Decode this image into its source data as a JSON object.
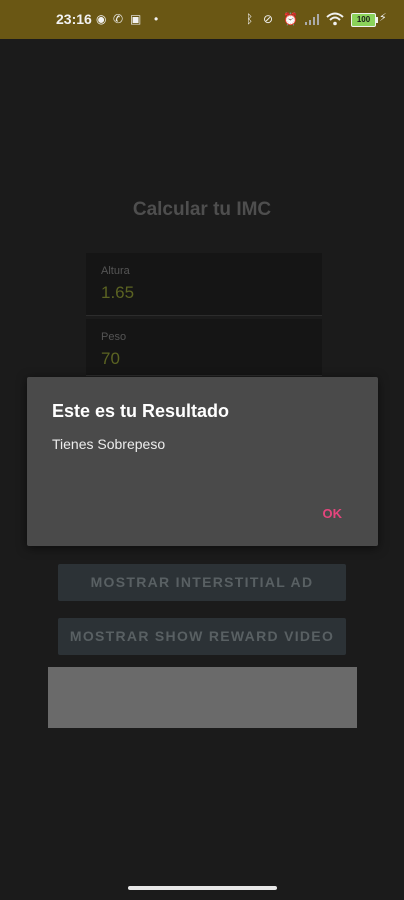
{
  "status_bar": {
    "time": "23:16",
    "battery": "100",
    "icons": [
      "messenger-icon",
      "whatsapp-icon",
      "notification-icon",
      "dot-icon",
      "bluetooth-icon",
      "mute-icon",
      "alarm-icon",
      "signal-icon",
      "wifi-icon",
      "battery-icon",
      "charging-icon"
    ]
  },
  "app": {
    "title": "Calcular tu IMC",
    "fields": {
      "height": {
        "label": "Altura",
        "value": "1.65"
      },
      "weight": {
        "label": "Peso",
        "value": "70"
      }
    },
    "buttons": {
      "interstitial": "MOSTRAR INTERSTITIAL AD",
      "reward": "MOSTRAR SHOW REWARD VIDEO"
    }
  },
  "dialog": {
    "title": "Este es tu Resultado",
    "message": "Tienes Sobrepeso",
    "ok": "OK"
  },
  "colors": {
    "status_bar": "#6a5714",
    "background": "#1b1b1b",
    "dialog": "#4a4a4a",
    "accent": "#e5457d"
  }
}
